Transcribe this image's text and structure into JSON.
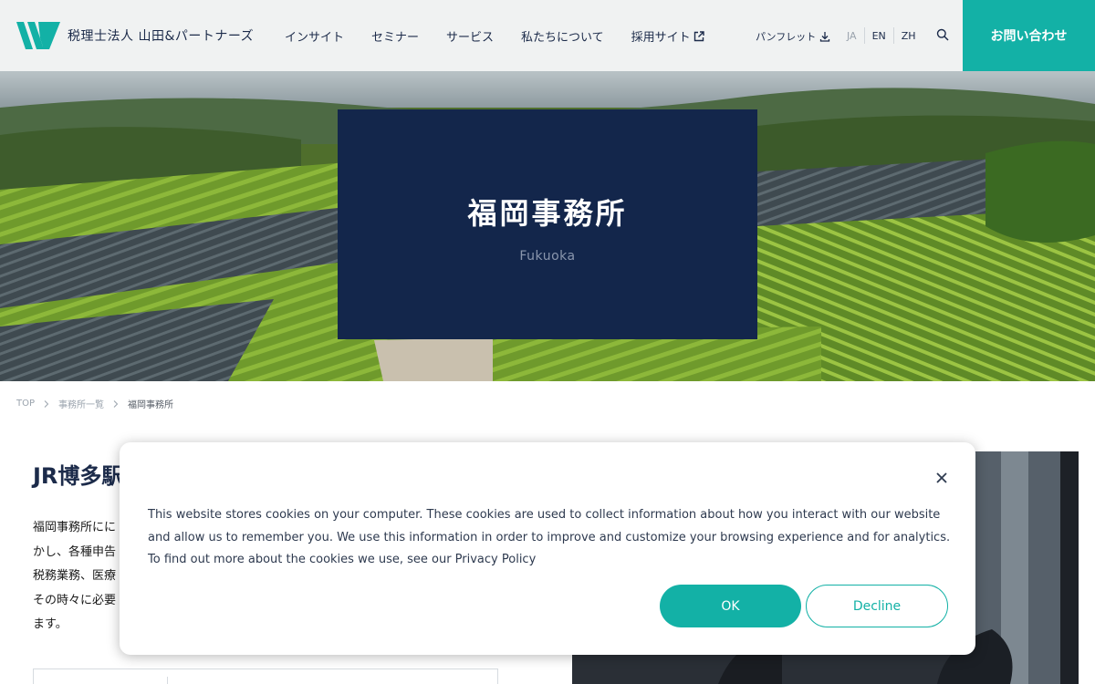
{
  "header": {
    "logo_text": "税理士法人 山田&パートナーズ",
    "nav": [
      "インサイト",
      "セミナー",
      "サービス",
      "私たちについて",
      "採用サイト"
    ],
    "pamphlet": "パンフレット",
    "languages": [
      "JA",
      "EN",
      "ZH"
    ],
    "active_language": "JA",
    "contact": "お問い合わせ"
  },
  "hero": {
    "title": "福岡事務所",
    "subtitle": "Fukuoka"
  },
  "breadcrumb": [
    "TOP",
    "事務所一覧",
    "福岡事務所"
  ],
  "main": {
    "heading": "JR博多駅",
    "paragraph_lines": [
      "福岡事務所にに",
      "かし、各種申告",
      "税務業務、医療",
      "その時々に必要",
      "ます。"
    ]
  },
  "cookie": {
    "text": "This website stores cookies on your computer. These cookies are used to collect information about how you interact with our website and allow us to remember you. We use this information in order to improve and customize your browsing experience and for analytics. To find out more about the cookies we use, see our Privacy Policy",
    "ok": "OK",
    "decline": "Decline"
  },
  "colors": {
    "brand_teal": "#13b1a6",
    "navy": "#13264b",
    "header_bg": "#f0f2f2"
  },
  "icons": [
    "logo-mark-icon",
    "external-link-icon",
    "download-icon",
    "search-icon",
    "chevron-right-icon",
    "close-icon"
  ]
}
